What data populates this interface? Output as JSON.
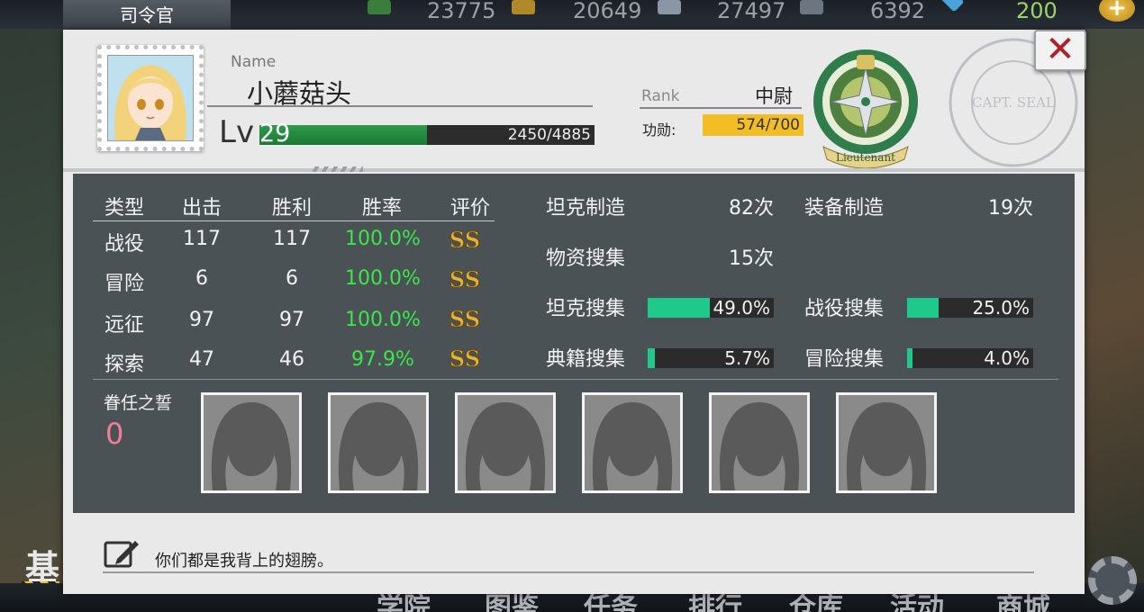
{
  "hud": {
    "tab_title": "司令官",
    "resources": [
      {
        "value": "23775",
        "icon": "fuel-barrel-icon",
        "color": "#3a7d3c"
      },
      {
        "value": "20649",
        "icon": "ammo-icon",
        "color": "#b08a2a"
      },
      {
        "value": "27497",
        "icon": "steel-icon",
        "color": "#8a96a3"
      },
      {
        "value": "6392",
        "icon": "aluminum-icon",
        "color": "#6d7680"
      }
    ],
    "premium_value": "200",
    "premium_icon": "diamond-icon",
    "add_button_label": "+",
    "base_label": "基",
    "bottom_nav": [
      "学院",
      "图鉴",
      "任务",
      "排行",
      "仓库",
      "活动",
      "商城"
    ]
  },
  "profile": {
    "name_label": "Name",
    "name": "小蘑菇头",
    "level_label": "Lv",
    "level": "29",
    "exp_text": "2450/4885",
    "exp_fraction": 0.5,
    "rank_label": "Rank",
    "rank": "中尉",
    "merit_label": "功勋:",
    "merit_text": "574/700",
    "merit_fraction": 0.82,
    "badge_text": "Lieutenant",
    "seal_text": "CAPT. SEAL",
    "close_label": "✕"
  },
  "battle_table": {
    "headers": [
      "类型",
      "出击",
      "胜利",
      "胜率",
      "评价"
    ],
    "rows": [
      {
        "type": "战役",
        "sorties": "117",
        "wins": "117",
        "rate": "100.0%",
        "grade": "SS"
      },
      {
        "type": "冒险",
        "sorties": "6",
        "wins": "6",
        "rate": "100.0%",
        "grade": "SS"
      },
      {
        "type": "远征",
        "sorties": "97",
        "wins": "97",
        "rate": "100.0%",
        "grade": "SS"
      },
      {
        "type": "探索",
        "sorties": "47",
        "wins": "46",
        "rate": "97.9%",
        "grade": "SS"
      }
    ]
  },
  "counters": {
    "tank_build_label": "坦克制造",
    "tank_build_value": "82次",
    "equip_build_label": "装备制造",
    "equip_build_value": "19次",
    "supply_label": "物资搜集",
    "supply_value": "15次"
  },
  "collections": [
    {
      "label": "坦克搜集",
      "value": "49.0%",
      "fraction": 0.49
    },
    {
      "label": "战役搜集",
      "value": "25.0%",
      "fraction": 0.25
    },
    {
      "label": "典籍搜集",
      "value": "5.7%",
      "fraction": 0.057
    },
    {
      "label": "冒险搜集",
      "value": "4.0%",
      "fraction": 0.04
    }
  ],
  "oath": {
    "label": "眷任之誓",
    "count": "0",
    "slot_count": 6
  },
  "signature": {
    "text": "你们都是我背上的翅膀。",
    "icon": "edit-icon"
  },
  "colors": {
    "panel_bg": "#e9e9ea",
    "stats_bg": "#4b5256",
    "win_rate_green": "#3ce64a",
    "collection_fill": "#1fc98a",
    "exp_fill": "#1f8a3e",
    "merit_fill": "#f2bd25",
    "oath_count_pink": "#f07f94",
    "close_red": "#b01f2a"
  }
}
